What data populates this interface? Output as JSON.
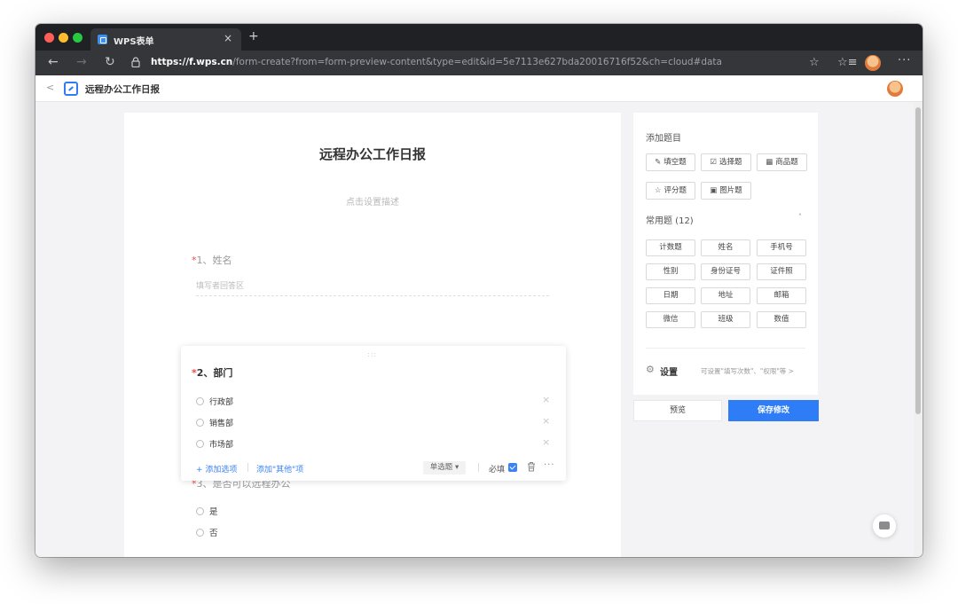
{
  "browser": {
    "tab_title": "WPS表单",
    "tab_close": "×",
    "new_tab": "+",
    "url_host": "https://f.wps.cn",
    "url_path": "/form-create?from=form-preview-content&type=edit&id=5e7113e627bda20016716f52&ch=cloud#data",
    "back": "←",
    "forward": "→",
    "reload": "↻",
    "star": "☆",
    "favorites": "☆≡",
    "more": "···"
  },
  "app": {
    "back": "<",
    "title": "远程办公工作日报"
  },
  "form": {
    "title": "远程办公工作日报",
    "description_placeholder": "点击设置描述",
    "questions": [
      {
        "required": "*",
        "label": "1、姓名",
        "answer_placeholder": "填写者回答区"
      },
      {
        "required": "*",
        "label": "2、部门",
        "options": [
          "行政部",
          "销售部",
          "市场部"
        ]
      },
      {
        "required": "*",
        "label": "3、是否可以远程办公",
        "options": [
          "是",
          "否"
        ]
      }
    ],
    "editor": {
      "drag_handle": ":::",
      "remove": "×",
      "add_option": "+ 添加选项",
      "add_other": "添加\"其他\"项",
      "type_select": "单选题 ▾",
      "required_label": "必填",
      "more": "···"
    }
  },
  "panel": {
    "add_section": "添加题目",
    "add_buttons": [
      {
        "icon": "✎",
        "label": "填空题"
      },
      {
        "icon": "☑",
        "label": "选择题"
      },
      {
        "icon": "▦",
        "label": "商品题"
      },
      {
        "icon": "☆",
        "label": "评分题"
      },
      {
        "icon": "▣",
        "label": "图片题"
      }
    ],
    "common_section": "常用题 (12)",
    "collapse": "˄",
    "common_items": [
      "计数题",
      "姓名",
      "手机号",
      "性别",
      "身份证号",
      "证件照",
      "日期",
      "地址",
      "邮箱",
      "微信",
      "班级",
      "数值"
    ],
    "settings_label": "设置",
    "settings_hint": "可设置\"填写次数\"、\"权限\"等 >",
    "settings_icon": "⚙"
  },
  "actions": {
    "preview": "预览",
    "save": "保存修改"
  },
  "colors": {
    "accent": "#2e7cf6",
    "required": "#f04a4a"
  }
}
